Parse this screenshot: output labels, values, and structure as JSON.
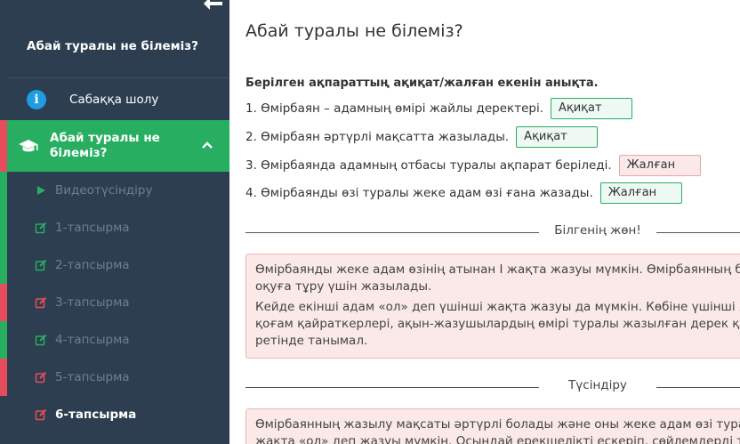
{
  "sidebar": {
    "course_title": "Абай туралы не білеміз?",
    "overview_label": "Сабаққа шолу",
    "active_section": "Абай туралы не білеміз?",
    "items": [
      {
        "label": "Видеотүсіндіру",
        "icon": "play-icon",
        "status": "done"
      },
      {
        "label": "1-тапсырма",
        "icon": "edit-icon",
        "status": "done"
      },
      {
        "label": "2-тапсырма",
        "icon": "edit-icon",
        "status": "done"
      },
      {
        "label": "3-тапсырма",
        "icon": "edit-icon",
        "status": "wrong"
      },
      {
        "label": "4-тапсырма",
        "icon": "edit-icon",
        "status": "done"
      },
      {
        "label": "5-тапсырма",
        "icon": "edit-icon",
        "status": "wrong"
      },
      {
        "label": "6-тапсырма",
        "icon": "edit-icon",
        "status": "current"
      }
    ]
  },
  "main": {
    "title": "Абай туралы не білеміз?",
    "instruction": "Берілген ақпараттың ақиқат/жалған екенін анықта.",
    "questions": [
      {
        "text": "1. Өмірбаян – адамның өмірі жайлы деректері.",
        "answer": "Ақиқат",
        "correct": true
      },
      {
        "text": "2. Өмірбаян әртүрлі мақсатта жазылады.",
        "answer": "Ақиқат",
        "correct": true
      },
      {
        "text": "3. Өмірбаянда адамның отбасы туралы ақпарат беріледі.",
        "answer": "Жалған",
        "correct": false
      },
      {
        "text": "4. Өмірбаянды өзі туралы жеке адам өзі ғана жазады.",
        "answer": "Жалған",
        "correct": true
      }
    ],
    "divider1": "Білгенің жөн!",
    "box1": [
      "Өмірбаянды жеке адам өзінің атынан І жақта жазуы мүмкін. Өмірбаянның бұл",
      "оқуға тұру үшін жазылады.",
      "Кейде екінші адам «ол» деп үшінші жақта жазуы да мүмкін. Көбіне үшінші жақ",
      "қоғам қайраткерлері, ақын-жазушылардың өмірі туралы жазылған дерек құжа",
      "ретінде танымал."
    ],
    "divider2": "Түсіндіру",
    "box2": [
      "Өмірбаянның жазылу мақсаты әртүрлі болады және оны жеке адам өзі туралы",
      "жақта «ол» деп жазуы мүмкін. Осындай ерекшелікті ескеріп, сөйлемдерді түсі"
    ]
  },
  "colors": {
    "sidebar_bg": "#2c3e50",
    "active_green": "#27ae60",
    "correct_border": "#27ae60",
    "wrong_border": "#e8a7a7",
    "info_blue": "#1e9de4"
  }
}
